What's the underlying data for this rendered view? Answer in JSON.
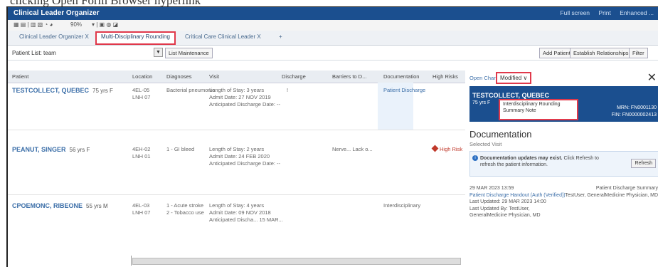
{
  "caption_fragment": "clicking Open Form Browser hyperlink",
  "window": {
    "title": "Clinical Leader Organizer",
    "actions": [
      "Full screen",
      "Print",
      "Enhanced ..."
    ]
  },
  "toolbar": {
    "zoom": "90%"
  },
  "tabs": [
    {
      "label": "Clinical Leader Organizer",
      "close": "X"
    },
    {
      "label": "Multi-Disciplinary Rounding",
      "active": true
    },
    {
      "label": "Critical Care Clinical Leader",
      "close": "X"
    },
    {
      "label": "+"
    }
  ],
  "patient_list": {
    "label": "Patient List:",
    "value": "team",
    "list_maintenance": "List Maintenance",
    "add_patient": "Add Patient",
    "establish_relationships": "Establish Relationships",
    "filter": "Filter"
  },
  "grid": {
    "headers": [
      "Patient",
      "Location",
      "Diagnoses",
      "Visit",
      "Discharge",
      "Barriers to D...",
      "Documentation",
      "High Risks"
    ],
    "rows": [
      {
        "name": "TESTCOLLECT, QUEBEC",
        "age": "75 yrs",
        "sex": "F",
        "location": "4EL-05\nLNH 07",
        "diagnoses": "Bacterial pneumonia",
        "visit": "Length of Stay: 3 years\nAdmit Date: 27 NOV 2019\nAnticipated Discharge Date: --",
        "discharge": "!",
        "barriers": "",
        "documentation": "Patient Discharge",
        "high_risk": ""
      },
      {
        "name": "PEANUT, SINGER",
        "age": "56 yrs",
        "sex": "F",
        "location": "4EH-02\nLNH 01",
        "diagnoses": "1 - GI bleed",
        "visit": "Length of Stay: 2 years\nAdmit Date: 24 FEB 2020\nAnticipated Discharge Date: --",
        "discharge": "",
        "barriers": "Nerve... Lack o...",
        "documentation": "",
        "high_risk": "High Risk"
      },
      {
        "name": "CPOEMONC, RIBEONE",
        "age": "55 yrs",
        "sex": "M",
        "location": "4EL-03\nLNH 07",
        "diagnoses": "1 - Acute stroke\n2 - Tobacco use",
        "visit": "Length of Stay: 4 years\nAdmit Date: 09 NOV 2018\nAnticipated Discha... 15 MAR...",
        "discharge": "",
        "barriers": "",
        "documentation": "Interdisciplinary",
        "high_risk": ""
      }
    ]
  },
  "panel": {
    "tab": "Open Chart",
    "modified": "Modified",
    "patient_name": "TESTCOLLECT, QUEBEC",
    "patient_age": "75 yrs  F",
    "mrn": "MRN: FN0001130",
    "fin": "FIN: FN0000002413",
    "dropdown": [
      "Interdisciplinary Rounding",
      "Summary Note"
    ],
    "doc_title": "Documentation",
    "doc_sub": "Selected Visit",
    "warn_bold": "Documentation updates may exist.",
    "warn_text": "Click Refresh to refresh the patient information.",
    "refresh": "Refresh",
    "entry": {
      "date": "29 MAR 2023 13:59",
      "link": "Patient Discharge Handout (Auth (Verified))",
      "updated": "Last Updated: 29 MAR 2023 14:00",
      "updated_by": "Last Updated By: TestUser,",
      "role": "GeneralMedicine Physician, MD",
      "type": "Patient Discharge Summary",
      "author": "TestUser, GeneralMedicine Physician, MD"
    }
  }
}
